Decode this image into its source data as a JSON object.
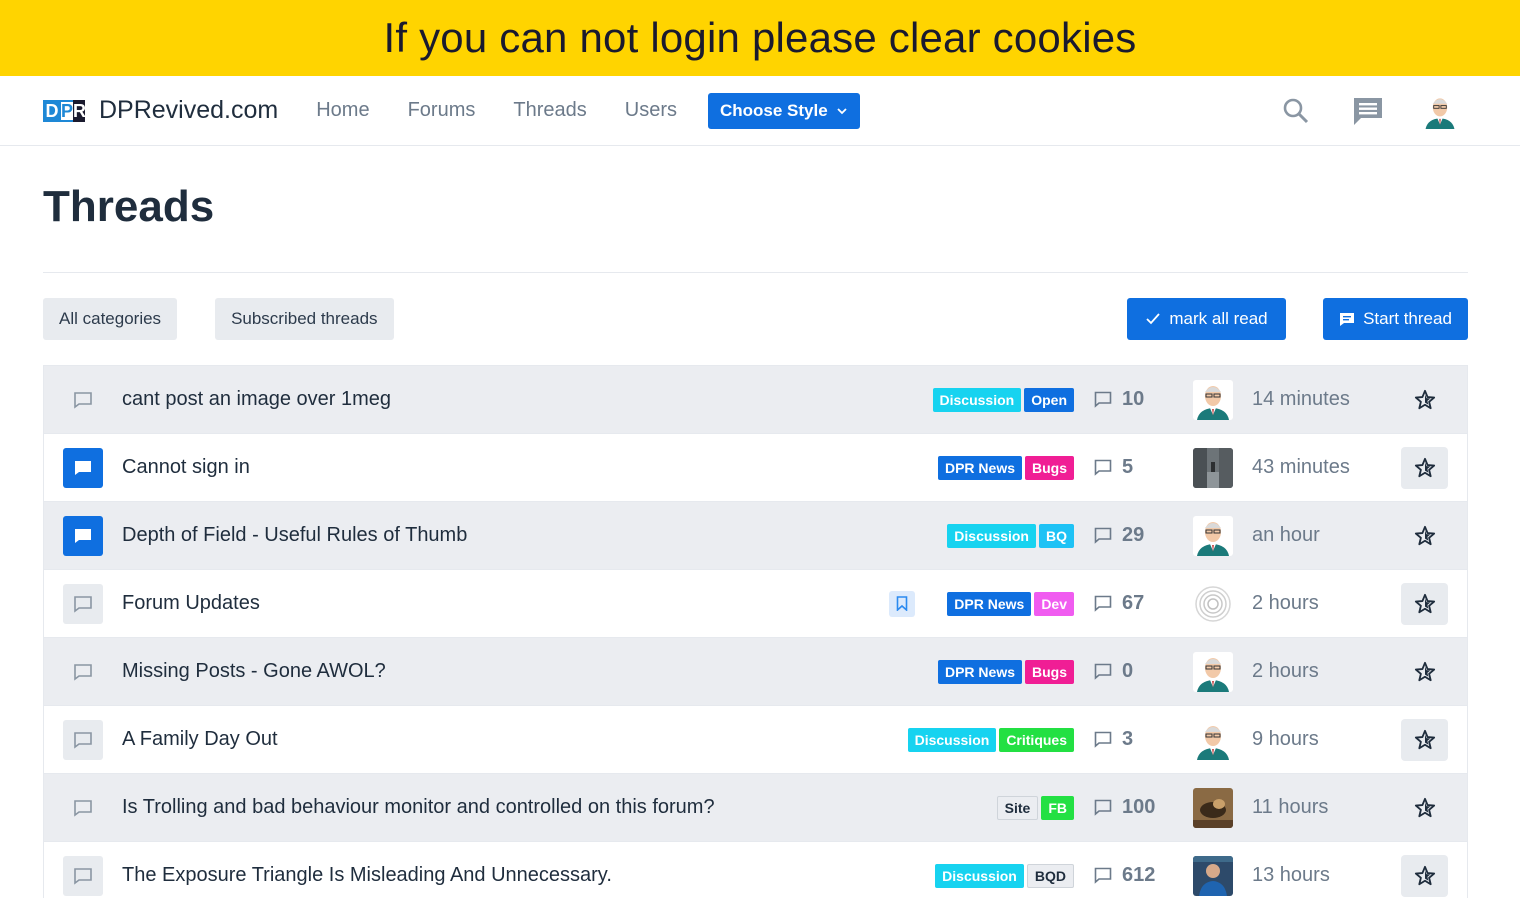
{
  "banner": {
    "text": "If you can not login please clear cookies"
  },
  "nav": {
    "site_name": "DPRevived.com",
    "logo_letters": "DPR",
    "links": [
      "Home",
      "Forums",
      "Threads",
      "Users"
    ],
    "choose_style": "Choose Style",
    "icons": [
      "search-icon",
      "messages-icon",
      "avatar"
    ]
  },
  "page": {
    "title": "Threads"
  },
  "filters": {
    "all_categories": "All categories",
    "subscribed": "Subscribed threads",
    "mark_all_read": "mark all read",
    "start_thread": "Start thread"
  },
  "threads": [
    {
      "title": "cant post an image over 1meg",
      "tags": [
        [
          "Discussion",
          "cyan"
        ],
        [
          "Open",
          "blue"
        ]
      ],
      "replies": "10",
      "time": "14 minutes",
      "status": "read",
      "avatar": "cartoon"
    },
    {
      "title": "Cannot sign in",
      "tags": [
        [
          "DPR News",
          "blue"
        ],
        [
          "Bugs",
          "magenta"
        ]
      ],
      "replies": "5",
      "time": "43 minutes",
      "status": "unread",
      "avatar": "photo-street"
    },
    {
      "title": "Depth of Field - Useful Rules of Thumb",
      "tags": [
        [
          "Discussion",
          "cyan"
        ],
        [
          "BQ",
          "sky"
        ]
      ],
      "replies": "29",
      "time": "an hour",
      "status": "unread",
      "avatar": "cartoon"
    },
    {
      "title": "Forum Updates",
      "tags": [
        [
          "DPR News",
          "blue"
        ],
        [
          "Dev",
          "pink"
        ]
      ],
      "replies": "67",
      "time": "2 hours",
      "status": "boxed",
      "avatar": "fingerprint",
      "bookmark": true
    },
    {
      "title": "Missing Posts - Gone AWOL?",
      "tags": [
        [
          "DPR News",
          "blue"
        ],
        [
          "Bugs",
          "magenta"
        ]
      ],
      "replies": "0",
      "time": "2 hours",
      "status": "read",
      "avatar": "cartoon"
    },
    {
      "title": "A Family Day Out",
      "tags": [
        [
          "Discussion",
          "cyan"
        ],
        [
          "Critiques",
          "green"
        ]
      ],
      "replies": "3",
      "time": "9 hours",
      "status": "boxed",
      "avatar": "cartoon"
    },
    {
      "title": "Is Trolling and bad behaviour monitor and controlled on this forum?",
      "tags": [
        [
          "Site",
          "light"
        ],
        [
          "FB",
          "green"
        ]
      ],
      "replies": "100",
      "time": "11 hours",
      "status": "read",
      "avatar": "photo-bird"
    },
    {
      "title": "The Exposure Triangle Is Misleading And Unnecessary.",
      "tags": [
        [
          "Discussion",
          "cyan"
        ],
        [
          "BQD",
          "light"
        ]
      ],
      "replies": "612",
      "time": "13 hours",
      "status": "boxed",
      "avatar": "photo-person"
    }
  ],
  "colors": {
    "accent": "#0f6fe0",
    "banner": "#ffd400",
    "row_alt": "#ebedf1"
  }
}
